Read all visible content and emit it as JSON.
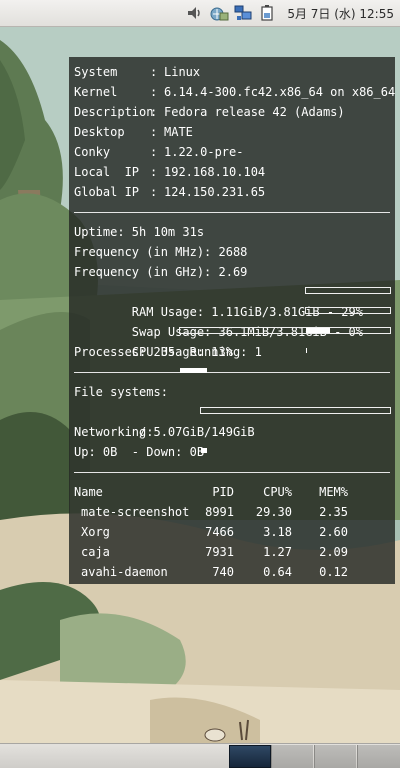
{
  "panel": {
    "clock": "5月 7日 (水) 12:55",
    "icons": [
      "volume-icon",
      "network-manager-icon",
      "network-icon",
      "battery-icon"
    ]
  },
  "conky": {
    "system_info": [
      {
        "key": "System",
        "value": "Linux"
      },
      {
        "key": "Kernel",
        "value": "6.14.4-300.fc42.x86_64 on x86_64"
      },
      {
        "key": "Description",
        "value": "Fedora release 42 (Adams)"
      },
      {
        "key": "Desktop",
        "value": "MATE"
      },
      {
        "key": "Conky",
        "value": "1.22.0-pre-"
      },
      {
        "key": "Local  IP",
        "value": "192.168.10.104"
      },
      {
        "key": "Global IP",
        "value": "124.150.231.65"
      }
    ],
    "uptime": "Uptime: 5h 10m 31s",
    "freq_mhz": "Frequency (in MHz): 2688",
    "freq_ghz": "Frequency (in GHz): 2.69",
    "ram": {
      "text": "RAM Usage: 1.11GiB/3.81GiB - 29%",
      "percent": 29
    },
    "swap": {
      "text": "Swap Usage: 36.1MiB/3.81GiB - 0%",
      "percent": 1
    },
    "cpu": {
      "text": "CPU Usage: 13%",
      "percent": 13
    },
    "processes": "Processes: 235  Running: 1",
    "fs_label": "File systems:",
    "fs": {
      "text": " / 5.07GiB/149GiB",
      "percent": 3
    },
    "net_label": "Networking:",
    "net": "Up: 0B  - Down: 0B",
    "table": {
      "headers": {
        "name": "Name",
        "pid": "PID",
        "cpu": "CPU%",
        "mem": "MEM%"
      },
      "rows": [
        {
          "name": "mate-screenshot",
          "pid": "8991",
          "cpu": "29.30",
          "mem": "2.35"
        },
        {
          "name": "Xorg",
          "pid": "7466",
          "cpu": "3.18",
          "mem": "2.60"
        },
        {
          "name": "caja",
          "pid": "7931",
          "cpu": "1.27",
          "mem": "2.09"
        },
        {
          "name": "avahi-daemon",
          "pid": "740",
          "cpu": "0.64",
          "mem": "0.12"
        }
      ]
    }
  }
}
